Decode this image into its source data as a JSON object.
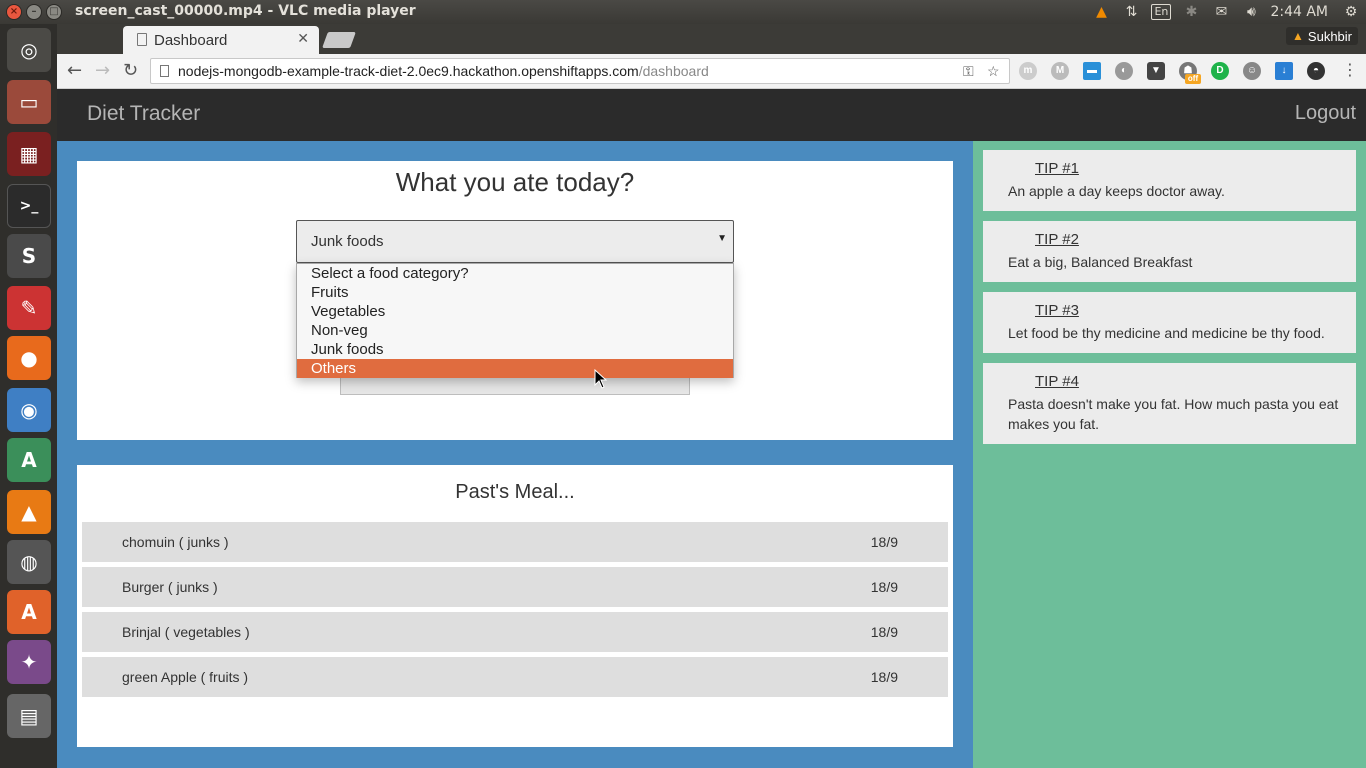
{
  "os": {
    "window_title": "screen_cast_00000.mp4 - VLC media player",
    "keyboard_layout": "En",
    "clock": "2:44 AM",
    "user": "Sukhbir"
  },
  "browser": {
    "tab_title": "Dashboard",
    "url_host": "nodejs-mongodb-example-track-diet-2.0ec9.hackathon.openshiftapps.com",
    "url_path": "/dashboard",
    "ext_badge": "off"
  },
  "app": {
    "brand": "Diet Tracker",
    "logout_label": "Logout",
    "entry": {
      "title": "What you ate today?",
      "selected_category": "Junk foods",
      "options": [
        "Select a food category?",
        "Fruits",
        "Vegetables",
        "Non-veg",
        "Junk foods",
        "Others"
      ],
      "highlighted_option": "Others"
    },
    "past_meals": {
      "title": "Past's Meal...",
      "rows": [
        {
          "name": "chomuin ( junks )",
          "date": "18/9"
        },
        {
          "name": "Burger ( junks )",
          "date": "18/9"
        },
        {
          "name": "Brinjal ( vegetables )",
          "date": "18/9"
        },
        {
          "name": "green Apple ( fruits )",
          "date": "18/9"
        }
      ]
    },
    "tips": [
      {
        "title": "TIP #1",
        "text": "An apple a day keeps doctor away."
      },
      {
        "title": "TIP #2",
        "text": "Eat a big, Balanced Breakfast"
      },
      {
        "title": "TIP #3",
        "text": "Let food be thy medicine and medicine be thy food."
      },
      {
        "title": "TIP #4",
        "text": "Pasta doesn't make you fat. How much pasta you eat makes you fat."
      }
    ]
  },
  "colors": {
    "main_bg": "#4a8bbf",
    "tips_bg": "#6dbe9a",
    "navbar_bg": "#2b2b2b",
    "option_highlight": "#e06c3f"
  }
}
